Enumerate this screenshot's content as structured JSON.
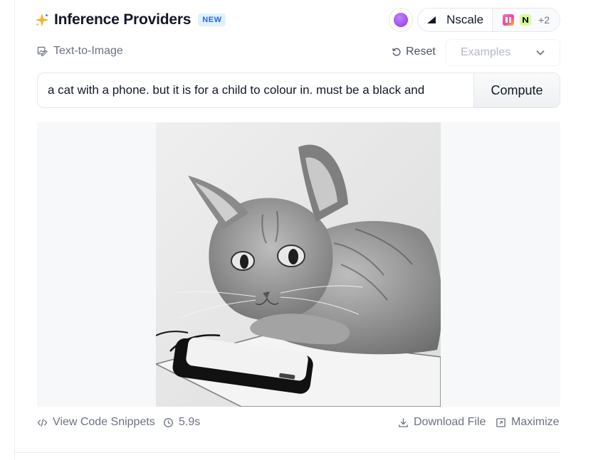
{
  "header": {
    "title": "Inference Providers",
    "badge": "NEW",
    "provider": "Nscale",
    "more_providers": "+2",
    "icons": [
      "sparkle-icon",
      "nscale-icon",
      "fal-icon",
      "n-icon"
    ]
  },
  "task": {
    "label": "Text-to-Image",
    "reset_label": "Reset",
    "examples_placeholder": "Examples"
  },
  "prompt": {
    "value": "a cat with a phone. but it is for a child to colour in. must be a black and",
    "compute_label": "Compute"
  },
  "output": {
    "image_alt": "generated image"
  },
  "footer": {
    "code_label": "View Code Snippets",
    "timing": "5.9s",
    "download_label": "Download File",
    "maximize_label": "Maximize"
  },
  "colors": {
    "accent_badge_bg": "#e0f2fe",
    "accent_badge_text": "#2563eb",
    "avatar": "#a855f7"
  }
}
